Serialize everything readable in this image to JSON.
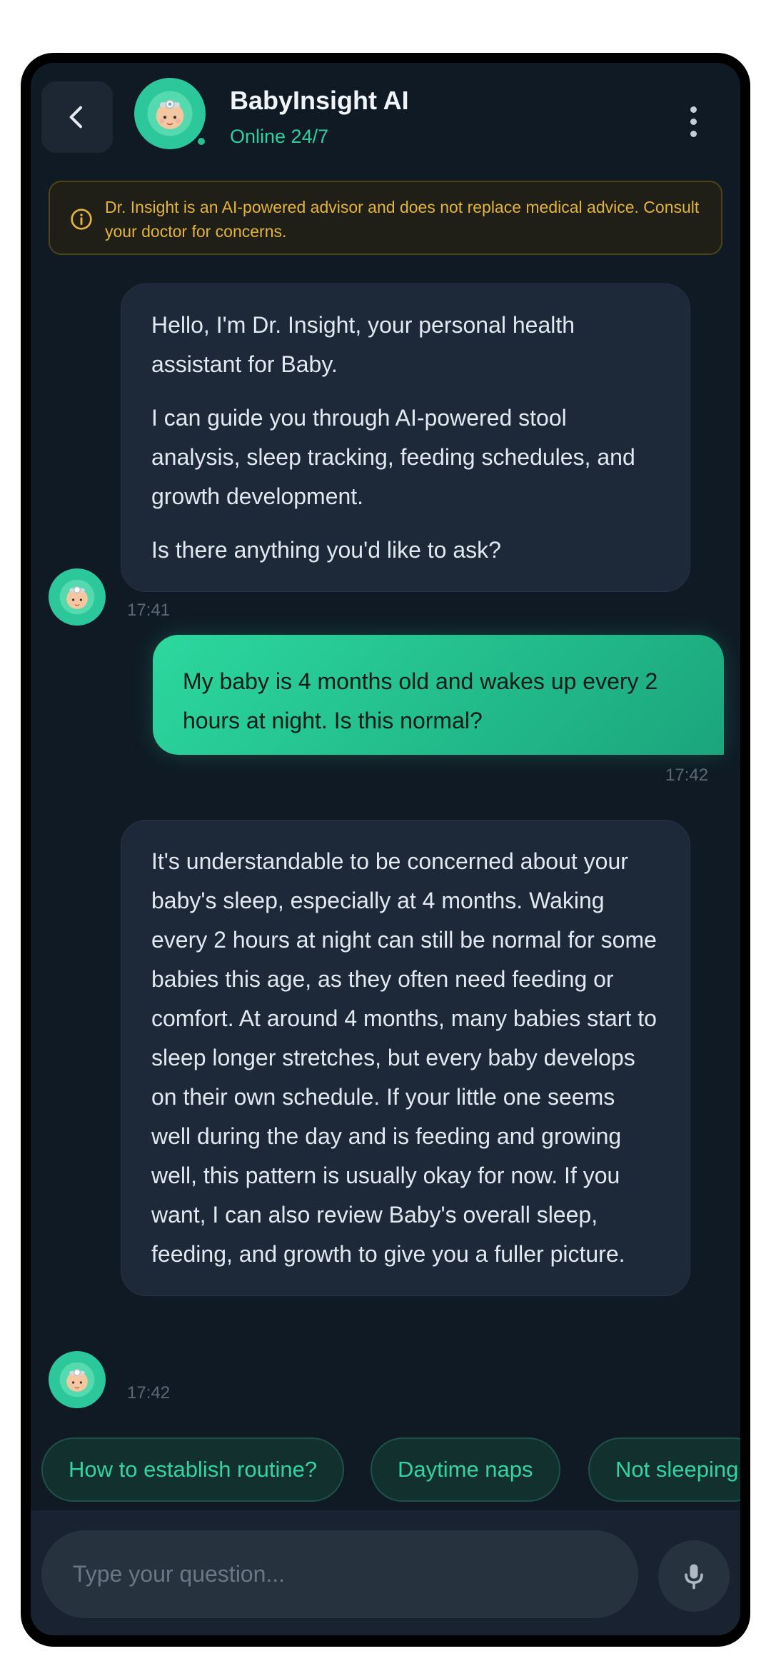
{
  "header": {
    "title": "BabyInsight AI",
    "status": "Online 24/7"
  },
  "disclaimer": {
    "text": "Dr. Insight is an AI-powered advisor and does not replace medical advice. Consult your doctor for concerns."
  },
  "messages": [
    {
      "sender": "bot",
      "paragraphs": [
        "Hello, I'm Dr. Insight, your personal health assistant for Baby.",
        "I can guide you through AI-powered stool analysis, sleep tracking, feeding schedules, and growth development.",
        "Is there anything you'd like to ask?"
      ],
      "time": "17:41"
    },
    {
      "sender": "user",
      "text": "My baby is 4 months old and wakes up every 2 hours at night. Is this normal?",
      "time": "17:42"
    },
    {
      "sender": "bot",
      "text": "It's understandable to be concerned about your baby's sleep, especially at 4 months. Waking every 2 hours at night can still be normal for some babies this age, as they often need feeding or comfort. At around 4 months, many babies start to sleep longer stretches, but every baby develops on their own schedule. If your little one seems well during the day and is feeding and growing well, this pattern is usually okay for now. If you want, I can also review Baby's overall sleep, feeding, and growth to give you a fuller picture.",
      "time": "17:42"
    }
  ],
  "suggestions": [
    "How to establish routine?",
    "Daytime naps",
    "Not sleeping"
  ],
  "input": {
    "placeholder": "Type your question...",
    "value": ""
  },
  "icons": {
    "back": "chevron-left-icon",
    "menu": "more-vertical-icon",
    "info": "info-icon",
    "mic": "microphone-icon",
    "avatar": "doctor-baby-icon"
  },
  "colors": {
    "accent": "#2ecf9c",
    "background": "#0f1a24",
    "bot_bubble": "#1d2838",
    "warning": "#e3b341"
  }
}
